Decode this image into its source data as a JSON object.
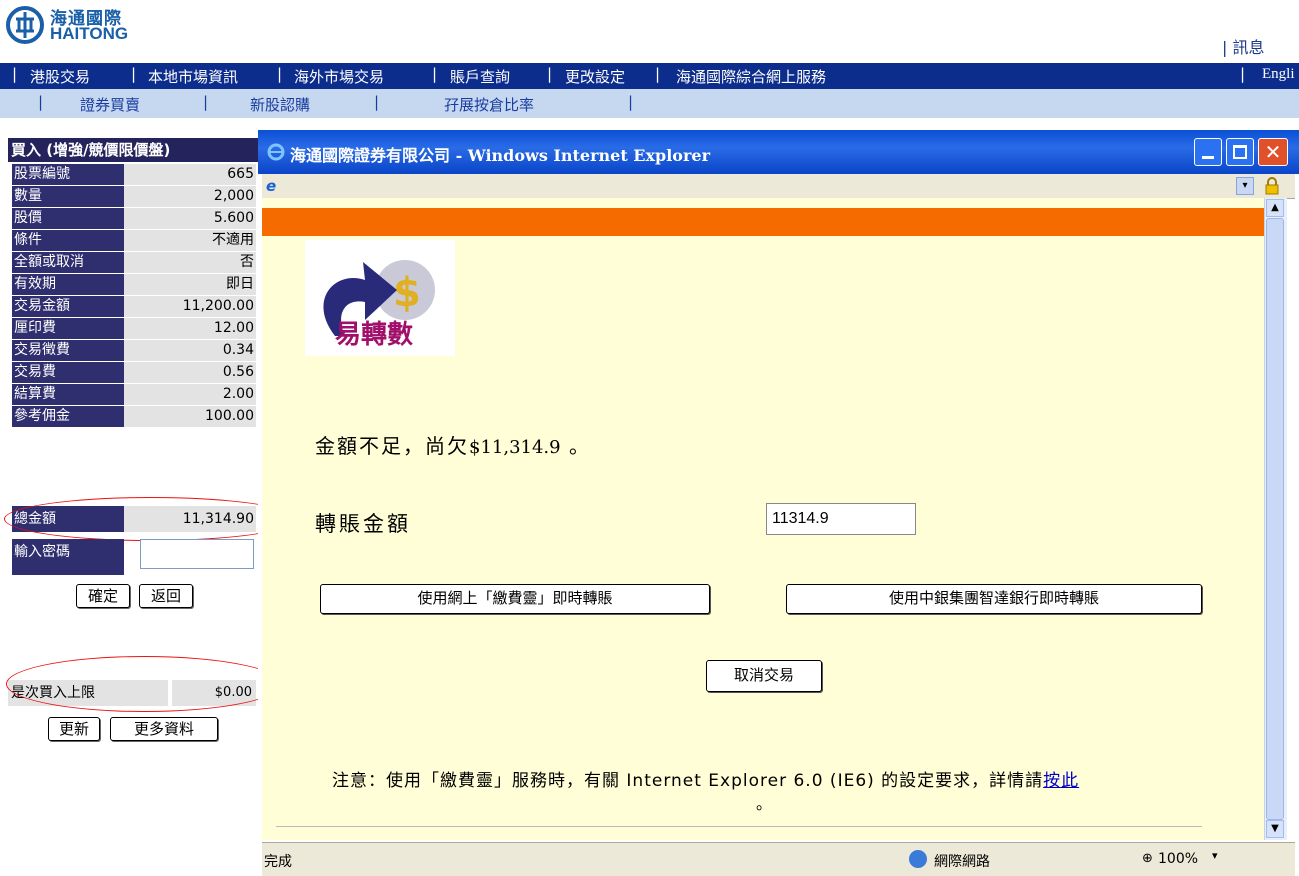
{
  "header": {
    "brand_cn": "海通國際",
    "brand_en": "HAITONG",
    "message_link": "| 訊息"
  },
  "nav_main": [
    "港股交易",
    "本地市場資訊",
    "海外市場交易",
    "賬戶查詢",
    "更改設定",
    "海通國際綜合網上服務"
  ],
  "nav_main_right": "Engli",
  "nav_sub": [
    "證券買賣",
    "新股認購",
    "孖展按倉比率"
  ],
  "order": {
    "title": "買入 (增強/競價限價盤)",
    "rows": [
      {
        "label": "股票編號",
        "value": "665"
      },
      {
        "label": "數量",
        "value": "2,000"
      },
      {
        "label": "股價",
        "value": "5.600"
      },
      {
        "label": "條件",
        "value": "不適用"
      },
      {
        "label": "全額或取消",
        "value": "否"
      },
      {
        "label": "有效期",
        "value": "即日"
      },
      {
        "label": "交易金額",
        "value": "11,200.00"
      },
      {
        "label": "厘印費",
        "value": "12.00"
      },
      {
        "label": "交易徵費",
        "value": "0.34"
      },
      {
        "label": "交易費",
        "value": "0.56"
      },
      {
        "label": "結算費",
        "value": "2.00"
      },
      {
        "label": "參考佣金",
        "value": "100.00"
      },
      {
        "label": "總金額",
        "value": "11,314.90"
      }
    ],
    "password_label": "輸入密碼",
    "password_value": "",
    "confirm_label": "確定",
    "back_label": "返回",
    "limit_label": "是次買入上限",
    "limit_value": "$0.00",
    "refresh_label": "更新",
    "more_label": "更多資料"
  },
  "popup": {
    "title": "海通國際證券有限公司 - Windows Internet Explorer",
    "logo_text": "易轉數",
    "insufficient_prefix": "金額不足，尚欠",
    "insufficient_amount": "$11,314.9",
    "insufficient_suffix": "。",
    "transfer_label": "轉賬金額",
    "transfer_value": "11314.9",
    "btn_pps": "使用網上「繳費靈」即時轉賬",
    "btn_boc": "使用中銀集團智達銀行即時轉賬",
    "btn_cancel": "取消交易",
    "note_text": "注意：使用「繳費靈」服務時，有關 Internet Explorer 6.0 (IE6) 的設定要求，詳情請",
    "note_link": "按此",
    "note_end": "。",
    "status_done": "完成",
    "status_zone": "網際網路",
    "zoom": "100%"
  },
  "colors": {
    "nav_main_bg": "#0d2d8c",
    "label_bg": "#2f2e6e",
    "orange_bar": "#f56b00",
    "content_bg": "#fffed6",
    "highlight": "#e11111"
  }
}
